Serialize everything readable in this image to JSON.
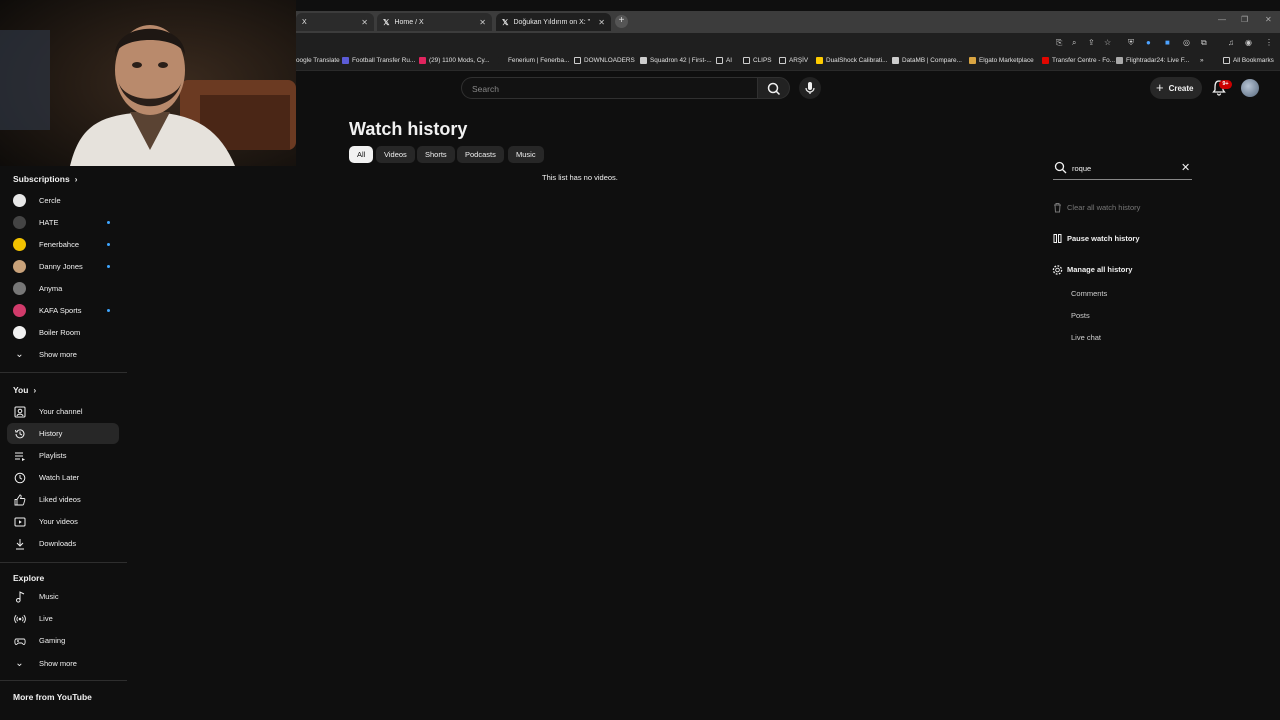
{
  "browser": {
    "tabs": [
      {
        "title": "X",
        "active": false
      },
      {
        "title": "Home / X",
        "active": false
      },
      {
        "title": "Doğukan Yıldırım on X: \" 🚨 Fe",
        "active": true
      }
    ],
    "new_tab_label": "+",
    "bookmarks": [
      {
        "label": "oogle Translate",
        "color": "#4285f4"
      },
      {
        "label": "Football Transfer Ru...",
        "color": "#5b5bd6"
      },
      {
        "label": "(29) 1100 Mods, Cy...",
        "color": "#e0245e"
      },
      {
        "label": "Fenerium | Fenerba...",
        "color": "#1f1f1f"
      },
      {
        "label": "DOWNLOADERS",
        "color": "folder"
      },
      {
        "label": "Squadron 42 | First-...",
        "color": "#cccccc"
      },
      {
        "label": "AI",
        "color": "folder"
      },
      {
        "label": "CLIPS",
        "color": "folder"
      },
      {
        "label": "ARŞİV",
        "color": "folder"
      },
      {
        "label": "DualShock Calibrati...",
        "color": "#ffcc00"
      },
      {
        "label": "DataMB | Compare...",
        "color": "#cccccc"
      },
      {
        "label": "Elgato Marketplace",
        "color": "#d9a441"
      },
      {
        "label": "Transfer Centre - Fo...",
        "color": "#e10600"
      },
      {
        "label": "Flightradar24: Live F...",
        "color": "#aaaaaa"
      }
    ],
    "more_bookmarks": "»",
    "all_bookmarks": "All Bookmarks"
  },
  "header": {
    "search_placeholder": "Search",
    "create_label": "Create",
    "notifications_badge": "9+"
  },
  "sidebar": {
    "subscriptions_title": "Subscriptions",
    "subscriptions": [
      {
        "label": "Cercle",
        "color": "#e8e8e8",
        "new": false
      },
      {
        "label": "HATE",
        "color": "#444444",
        "new": true
      },
      {
        "label": "Fenerbahce",
        "color": "#f2c200",
        "new": true
      },
      {
        "label": "Danny Jones",
        "color": "#c9a27a",
        "new": true
      },
      {
        "label": "Anyma",
        "color": "#777777",
        "new": false
      },
      {
        "label": "KAFA Sports",
        "color": "#d13b6b",
        "new": true
      },
      {
        "label": "Boiler Room",
        "color": "#f1f1f1",
        "new": false
      }
    ],
    "subs_show_more": "Show more",
    "you_title": "You",
    "you_items": [
      {
        "label": "Your channel",
        "icon": "channel-icon",
        "active": false
      },
      {
        "label": "History",
        "icon": "history-icon",
        "active": true
      },
      {
        "label": "Playlists",
        "icon": "playlists-icon",
        "active": false
      },
      {
        "label": "Watch Later",
        "icon": "clock-icon",
        "active": false
      },
      {
        "label": "Liked videos",
        "icon": "thumbs-up-icon",
        "active": false
      },
      {
        "label": "Your videos",
        "icon": "video-icon",
        "active": false
      },
      {
        "label": "Downloads",
        "icon": "download-icon",
        "active": false
      }
    ],
    "explore_title": "Explore",
    "explore_items": [
      {
        "label": "Music",
        "icon": "music-note-icon"
      },
      {
        "label": "Live",
        "icon": "live-icon"
      },
      {
        "label": "Gaming",
        "icon": "gaming-icon"
      }
    ],
    "explore_show_more": "Show more",
    "more_title": "More from YouTube"
  },
  "main": {
    "title": "Watch history",
    "chips": [
      {
        "label": "All",
        "active": true
      },
      {
        "label": "Videos",
        "active": false
      },
      {
        "label": "Shorts",
        "active": false
      },
      {
        "label": "Podcasts",
        "active": false
      },
      {
        "label": "Music",
        "active": false
      }
    ],
    "empty_message": "This list has no videos."
  },
  "history_panel": {
    "search_value": "roque",
    "clear_label": "Clear all watch history",
    "pause_label": "Pause watch history",
    "manage_label": "Manage all history",
    "sub_items": [
      "Comments",
      "Posts",
      "Live chat"
    ]
  }
}
